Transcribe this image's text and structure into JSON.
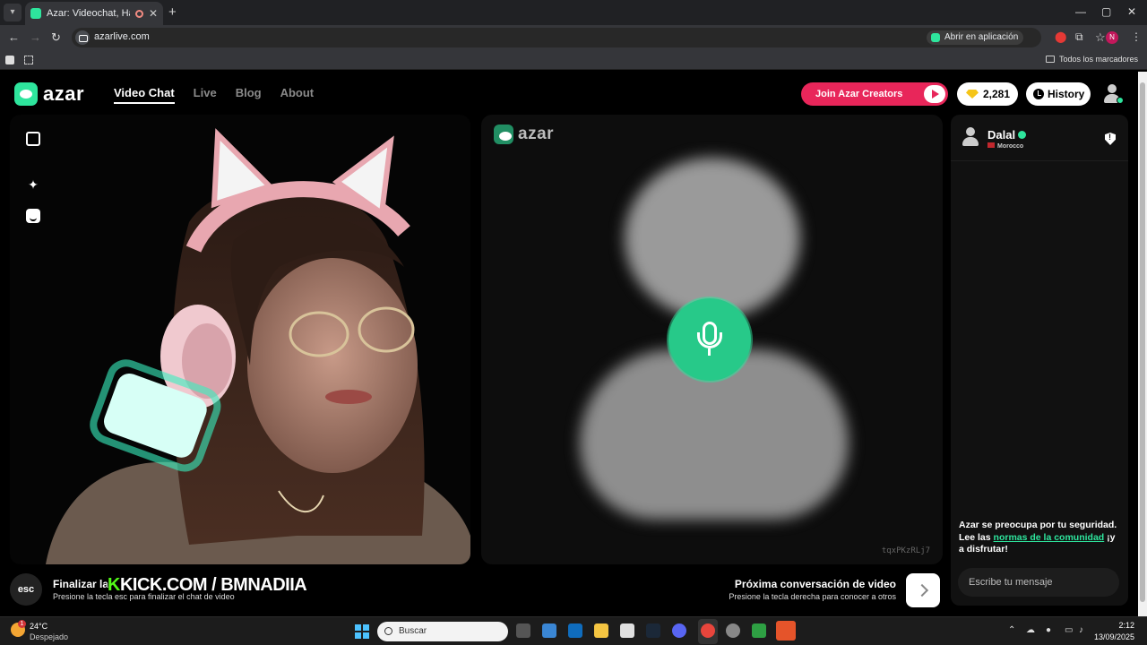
{
  "browser": {
    "tab_title": "Azar: Videochat, Haz nuevos amigos",
    "url": "azarlive.com",
    "open_in_app": "Abrir en aplicación",
    "all_bookmarks": "Todos los marcadores",
    "profile_initial": "N"
  },
  "header": {
    "logo": "azar",
    "nav": [
      "Video Chat",
      "Live",
      "Blog",
      "About"
    ],
    "creators_button": "Join Azar Creators",
    "gems": "2,281",
    "history": "History"
  },
  "video_right": {
    "logo": "azar",
    "session_id": "tqxPKzRLj7"
  },
  "chat": {
    "peer_name": "Dalal",
    "peer_country": "Morocco",
    "safety_text_1": "Azar se preocupa por tu seguridad. Lee las ",
    "safety_link": "normas de la comunidad",
    "safety_text_2": " ¡y a disfrutar!",
    "message_placeholder": "Escribe tu mensaje"
  },
  "bottom": {
    "esc_label": "esc",
    "end_title": "Finalizar la",
    "end_sub": "Presione la tecla esc para finalizar el chat de video",
    "overlay_k": "K",
    "overlay_text": "KICK.COM / BMNADIIA",
    "next_title": "Próxima conversación de video",
    "next_sub": "Presione la tecla derecha para conocer a otros"
  },
  "taskbar": {
    "weather_badge": "1",
    "temperature": "24°C",
    "condition": "Despejado",
    "search_placeholder": "Buscar",
    "time": "2:12",
    "date": "13/09/2025"
  },
  "colors": {
    "brand_green": "#2ee59d",
    "creators_red": "#e8265a",
    "kick_green": "#53fc18"
  }
}
